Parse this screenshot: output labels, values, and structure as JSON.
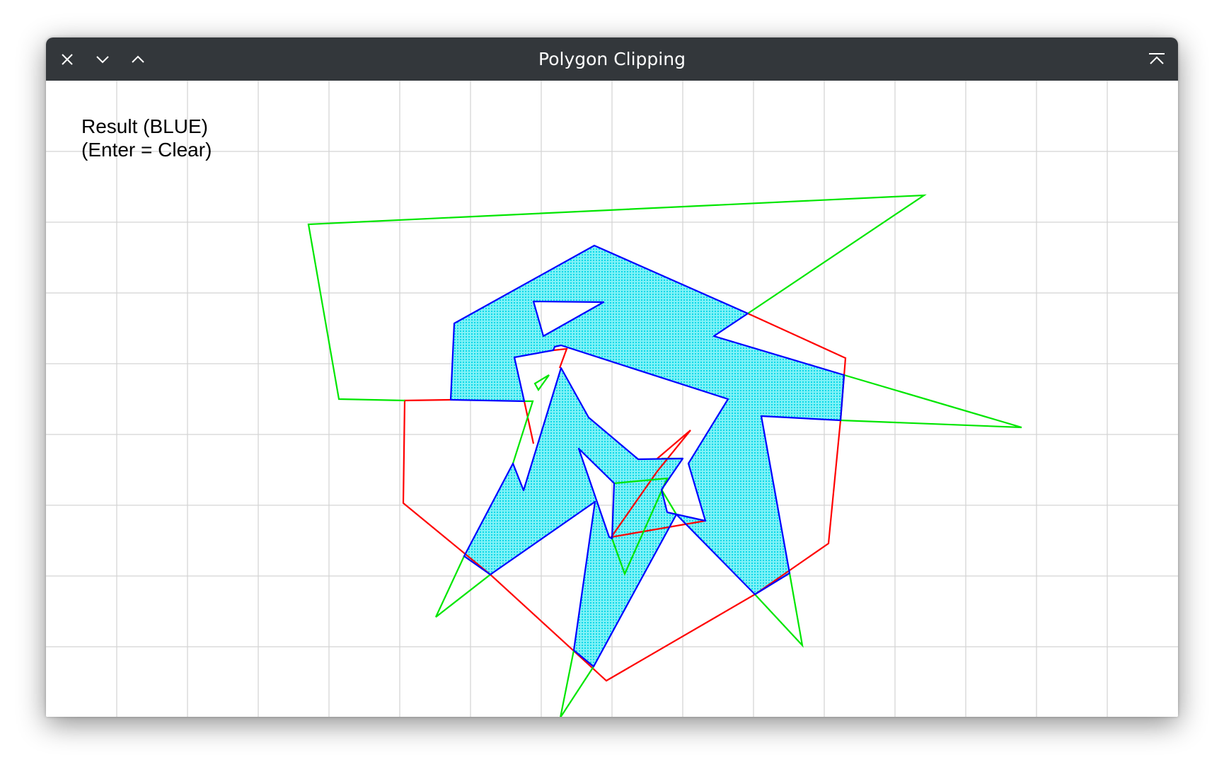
{
  "window": {
    "title": "Polygon Clipping",
    "buttons": {
      "close": "close-icon",
      "minimize": "chevron-down-icon",
      "maximize": "chevron-up-icon",
      "keep_above": "keep-above-icon"
    }
  },
  "canvas": {
    "info_line1": "Result (BLUE)",
    "info_line2": "(Enter = Clear)"
  },
  "colors": {
    "titlebar": "#33373b",
    "grid": "#d3d3d3",
    "clip_polygon": "#ff0000",
    "subject_polygon": "#00e600",
    "result_polygon": "#0000ff",
    "result_fill": "#00e5ee"
  }
}
